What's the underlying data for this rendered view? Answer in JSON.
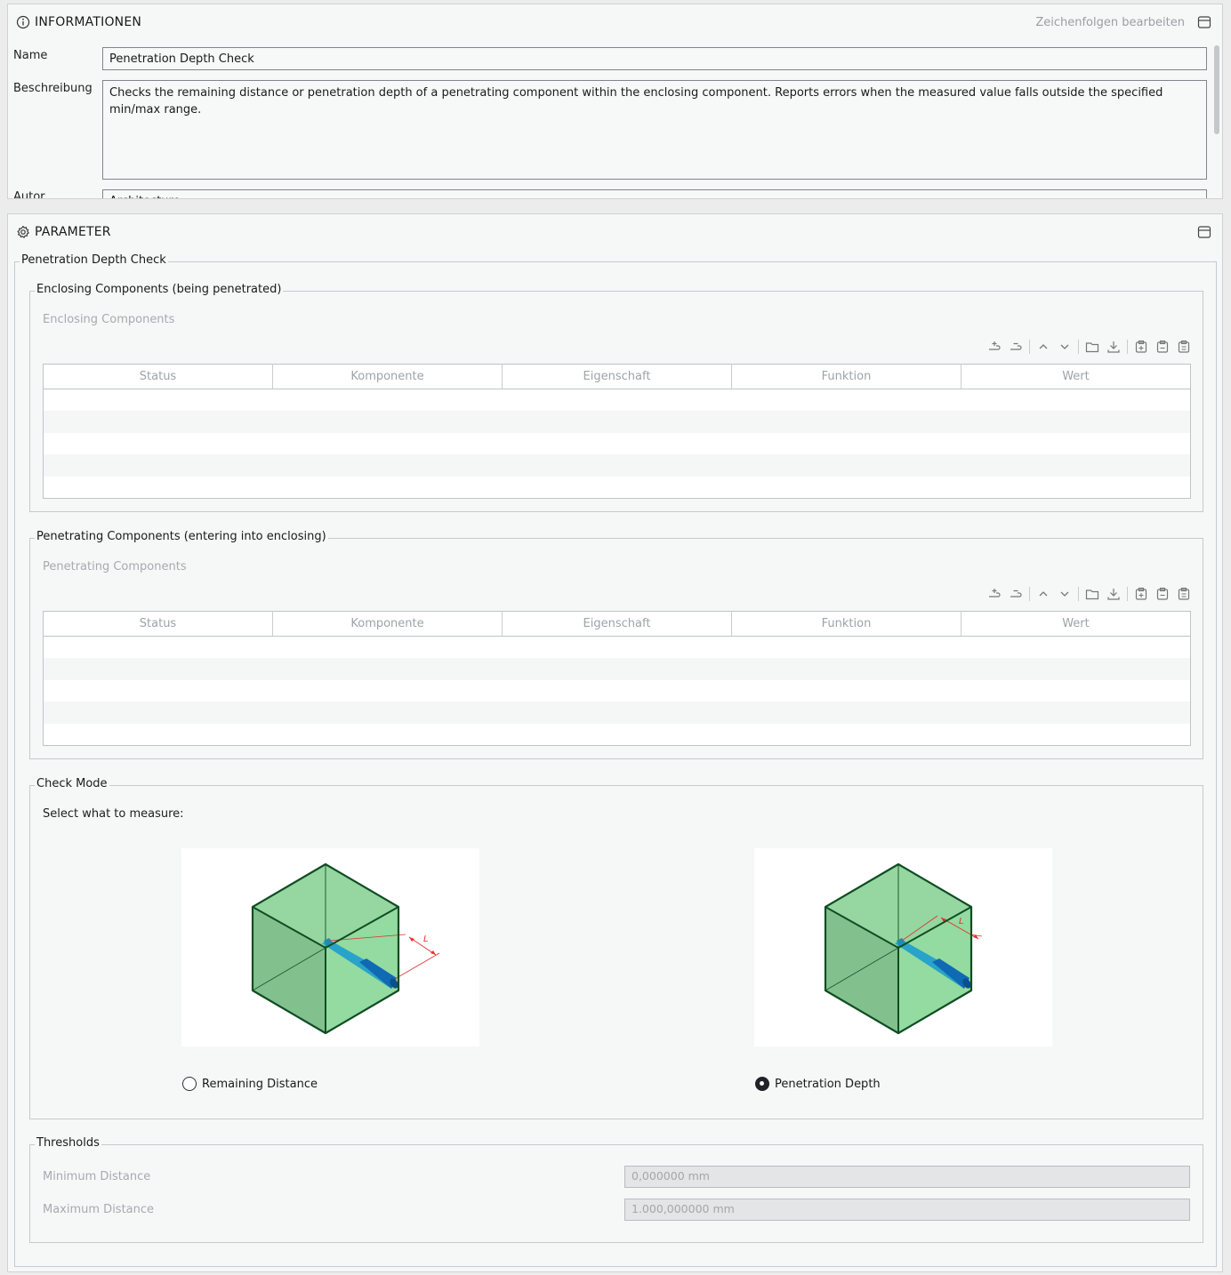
{
  "info": {
    "title": "INFORMATIONEN",
    "edit_strings": "Zeichenfolgen bearbeiten",
    "fields": {
      "name_label": "Name",
      "name_value": "Penetration Depth Check",
      "description_label": "Beschreibung",
      "description_value": "Checks the remaining distance or penetration depth of a penetrating component within the enclosing component. Reports errors when the measured value falls outside the specified min/max range.",
      "author_label": "Autor",
      "author_value": "Architecture"
    }
  },
  "parameter": {
    "title": "PARAMETER",
    "check_group": "Penetration Depth Check",
    "enclosing": {
      "legend": "Enclosing Components (being penetrated)",
      "list_label": "Enclosing Components"
    },
    "penetrating": {
      "legend": "Penetrating Components (entering into enclosing)",
      "list_label": "Penetrating Components"
    },
    "columns": [
      "Status",
      "Komponente",
      "Eigenschaft",
      "Funktion",
      "Wert"
    ],
    "check_mode": {
      "legend": "Check Mode",
      "prompt": "Select what to measure:",
      "options": [
        {
          "label": "Remaining Distance",
          "selected": false
        },
        {
          "label": "Penetration Depth",
          "selected": true
        }
      ]
    },
    "thresholds": {
      "legend": "Thresholds",
      "min_label": "Minimum Distance",
      "min_value": "0,000000 mm",
      "max_label": "Maximum Distance",
      "max_value": "1.000,000000 mm"
    }
  },
  "colors": {
    "cube_fill": "#8fd49c",
    "cube_stroke": "#0f4d22",
    "rod": "#1a8fc8",
    "dimension": "#e03030"
  }
}
